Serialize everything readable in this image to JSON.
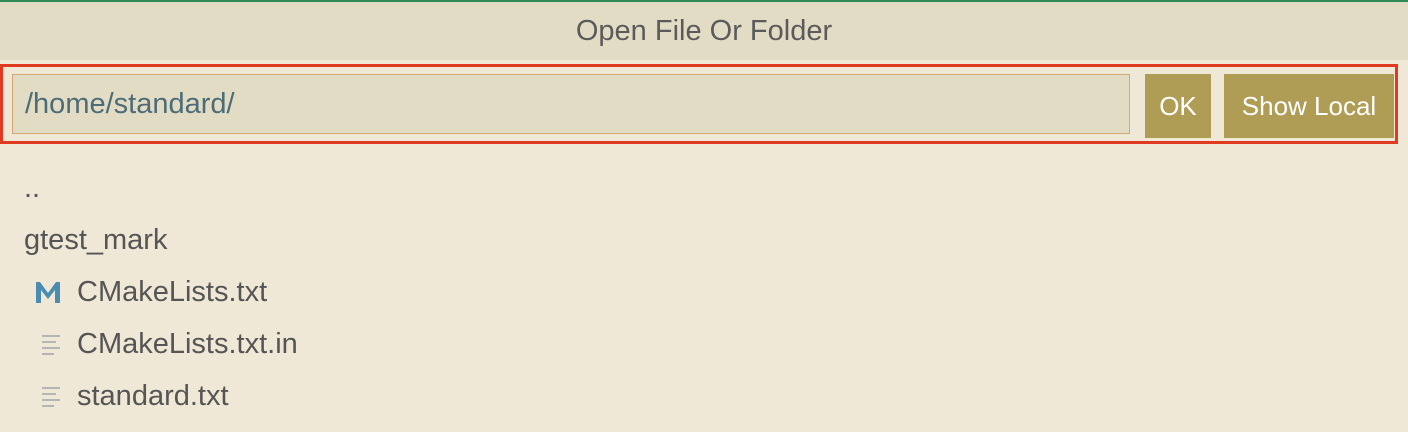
{
  "dialog": {
    "title": "Open File Or Folder"
  },
  "path_input": {
    "value": "/home/standard/"
  },
  "buttons": {
    "ok_label": "OK",
    "show_local_label": "Show Local"
  },
  "files": [
    {
      "label": "..",
      "icon": "none"
    },
    {
      "label": "gtest_mark",
      "icon": "none"
    },
    {
      "label": "CMakeLists.txt",
      "icon": "m-icon"
    },
    {
      "label": "CMakeLists.txt.in",
      "icon": "text-file-icon"
    },
    {
      "label": "standard.txt",
      "icon": "text-file-icon"
    }
  ],
  "colors": {
    "background": "#efe8d6",
    "titlebar": "#e2dcc5",
    "button": "#b09d55",
    "highlight_border": "#e03a22",
    "m_icon": "#4a8db1"
  }
}
